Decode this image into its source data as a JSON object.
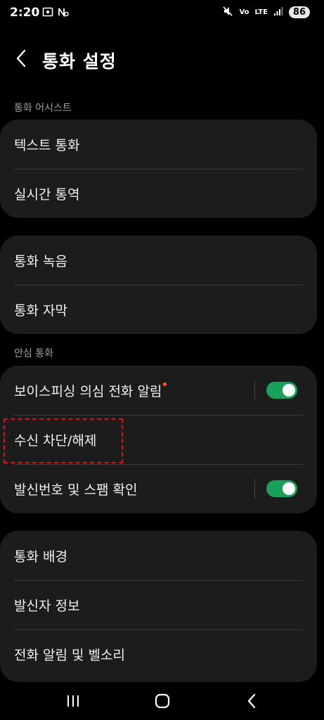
{
  "status_bar": {
    "time": "2:20",
    "left_icons": [
      "screenshot-icon",
      "nfc-icon"
    ],
    "volte_label": "Vo",
    "lte_label": "LTE",
    "battery": "86"
  },
  "header": {
    "title": "통화 설정",
    "back_icon": "back-chevron-icon"
  },
  "sections": {
    "assist_label": "통화 어시스트",
    "safe_call_label": "안심 통화"
  },
  "card1": {
    "items": [
      {
        "label": "텍스트 통화"
      },
      {
        "label": "실시간 통역"
      }
    ]
  },
  "card2": {
    "items": [
      {
        "label": "통화 녹음"
      },
      {
        "label": "통화 자막"
      }
    ]
  },
  "card3": {
    "items": [
      {
        "label": "보이스피싱 의심 전화 알림",
        "toggle": true,
        "badge": true
      },
      {
        "label": "수신 차단/해제"
      },
      {
        "label": "발신번호 및 스팸 확인",
        "toggle": true
      }
    ]
  },
  "card4": {
    "items": [
      {
        "label": "통화 배경"
      },
      {
        "label": "발신자 정보"
      },
      {
        "label": "전화 알림 및 벨소리"
      }
    ]
  },
  "colors": {
    "toggle_on": "#19a05a",
    "badge_dot": "#ff5a1f",
    "card_bg": "#1c1c1c"
  },
  "nav": {
    "recents_icon": "recents-icon",
    "home_icon": "home-icon",
    "back_icon": "back-icon"
  }
}
